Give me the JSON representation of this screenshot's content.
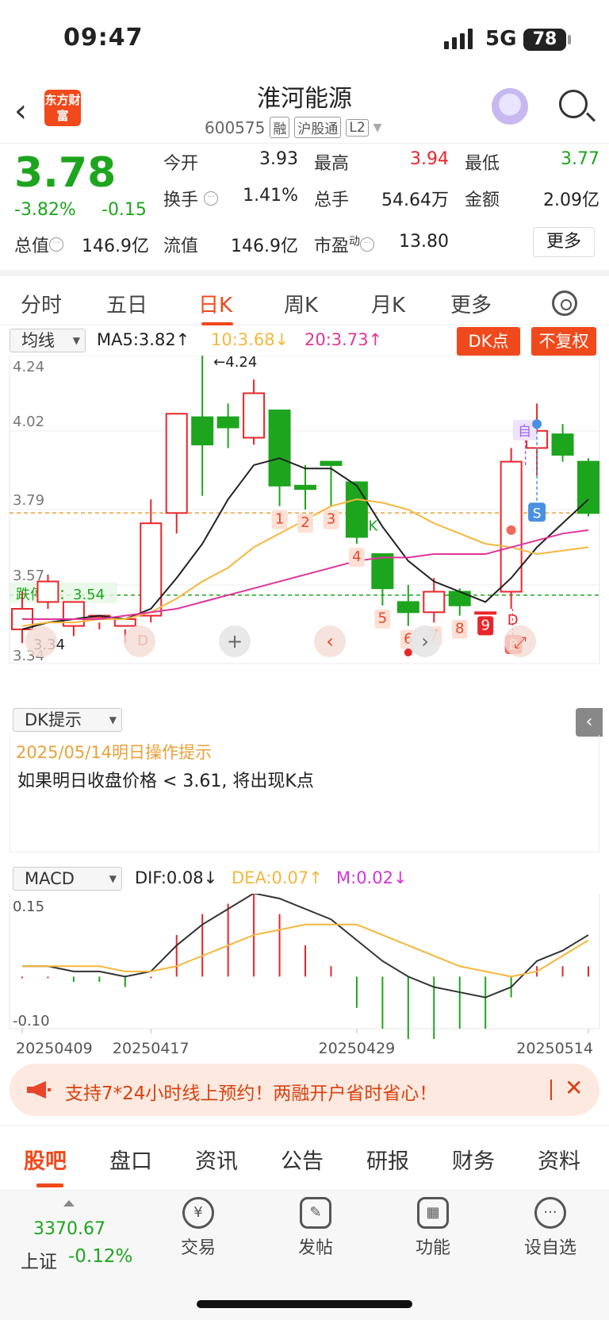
{
  "status": {
    "time": "09:47",
    "network": "5G",
    "battery": "78"
  },
  "header": {
    "back": "‹",
    "logo": "东方财富",
    "name": "淮河能源",
    "code": "600575",
    "tags": [
      "融",
      "沪股通",
      "L2"
    ]
  },
  "quote": {
    "price": "3.78",
    "pct": "-3.82%",
    "chg": "-0.15",
    "fields": {
      "open_label": "今开",
      "open": "3.93",
      "high_label": "最高",
      "high": "3.94",
      "low_label": "最低",
      "low": "3.77",
      "turnover_label": "换手",
      "turnover": "1.41%",
      "volume_label": "总手",
      "volume": "54.64万",
      "amount_label": "金额",
      "amount": "2.09亿",
      "mcap_label": "总值",
      "mcap": "146.9亿",
      "float_label": "流值",
      "float": "146.9亿",
      "pe_label": "市盈",
      "pe_sup": "动",
      "pe": "13.80"
    },
    "more": "更多"
  },
  "tabs": [
    "分时",
    "五日",
    "日K",
    "周K",
    "月K",
    "更多"
  ],
  "ma": {
    "selector": "均线",
    "ma5": "MA5:3.82↑",
    "ma10": "10:3.68↓",
    "ma20": "20:3.73↑",
    "dk_btn": "DK点",
    "fq_btn": "不复权"
  },
  "kline": {
    "y_labels": [
      "4.24",
      "4.02",
      "3.79",
      "3.57",
      "3.34"
    ],
    "stop_label": "跌停价：3.54",
    "max_label": "←4.24",
    "min_label": "3.34",
    "markers": [
      "1",
      "2",
      "3",
      "4",
      "5",
      "6",
      "7",
      "8",
      "9"
    ],
    "k_mark": "K",
    "d_marks": [
      "D",
      "D"
    ],
    "zi_mark": "自",
    "s_mark": "S",
    "b_mark": "B"
  },
  "dk": {
    "selector": "DK提示",
    "date": "2025/05/14明日操作提示",
    "text": "如果明日收盘价格 < 3.61, 将出现K点"
  },
  "macd_head": {
    "selector": "MACD",
    "dif": "DIF:0.08↓",
    "dea": "DEA:0.07↑",
    "m": "M:0.02↓"
  },
  "macd_axis": {
    "top": "0.15",
    "bottom": "-0.10",
    "dates": [
      "20250409",
      "20250417",
      "20250429",
      "20250514"
    ]
  },
  "banner": {
    "text": "支持7*24小时线上预约！两融开户省时省心！",
    "close": "✕"
  },
  "bottom_tabs": [
    "股吧",
    "盘口",
    "资讯",
    "公告",
    "研报",
    "财务",
    "资料"
  ],
  "dock": {
    "index_value": "3370.67",
    "index_name": "上证",
    "index_change": "-0.12%",
    "items": [
      "交易",
      "发帖",
      "功能",
      "设自选"
    ]
  },
  "colors": {
    "up": "#e8262a",
    "down": "#1ea51e",
    "accent": "#f04a1c",
    "ma5": "#222222",
    "ma10": "#f5b73c",
    "ma20": "#e0359a"
  },
  "chart_data": [
    {
      "type": "candlestick",
      "title": "",
      "x": [
        "20250409",
        "",
        "",
        "",
        "",
        "20250417",
        "",
        "",
        "",
        "",
        "",
        "",
        "",
        "20250429",
        "",
        "",
        "",
        "",
        "",
        "",
        "",
        "",
        "20250514"
      ],
      "ohlc": [
        [
          3.44,
          3.5,
          3.4,
          3.55
        ],
        [
          3.52,
          3.58,
          3.5,
          3.6
        ],
        [
          3.45,
          3.52,
          3.42,
          3.45
        ],
        [
          3.48,
          3.48,
          3.44,
          3.46
        ],
        [
          3.45,
          3.47,
          3.4,
          3.44
        ],
        [
          3.48,
          3.75,
          3.46,
          3.82
        ],
        [
          3.78,
          4.07,
          3.72,
          4.07
        ],
        [
          4.06,
          3.98,
          3.83,
          4.24
        ],
        [
          4.06,
          4.03,
          3.97,
          4.1
        ],
        [
          4.0,
          4.13,
          3.98,
          4.17
        ],
        [
          4.08,
          3.86,
          3.8,
          4.08
        ],
        [
          3.86,
          3.85,
          3.79,
          3.92
        ],
        [
          3.93,
          3.92,
          3.8,
          3.93
        ],
        [
          3.87,
          3.71,
          3.69,
          3.87
        ],
        [
          3.66,
          3.56,
          3.51,
          3.66
        ],
        [
          3.52,
          3.49,
          3.45,
          3.57
        ],
        [
          3.49,
          3.55,
          3.46,
          3.59
        ],
        [
          3.55,
          3.51,
          3.48,
          3.56
        ],
        [
          3.49,
          3.49,
          3.49,
          3.49
        ],
        [
          3.55,
          3.93,
          3.5,
          3.97
        ],
        [
          3.97,
          4.02,
          3.89,
          4.1
        ],
        [
          4.01,
          3.95,
          3.93,
          4.04
        ],
        [
          3.93,
          3.78,
          3.77,
          3.94
        ]
      ],
      "ma5": [
        3.44,
        3.46,
        3.47,
        3.48,
        3.47,
        3.5,
        3.59,
        3.69,
        3.82,
        3.92,
        3.94,
        3.91,
        3.91,
        3.86,
        3.74,
        3.64,
        3.58,
        3.55,
        3.52,
        3.59,
        3.68,
        3.75,
        3.82
      ],
      "ma10": [
        3.45,
        3.46,
        3.46,
        3.47,
        3.47,
        3.49,
        3.53,
        3.58,
        3.62,
        3.68,
        3.72,
        3.76,
        3.8,
        3.82,
        3.81,
        3.79,
        3.75,
        3.72,
        3.69,
        3.68,
        3.66,
        3.67,
        3.68
      ],
      "ma20": [
        3.47,
        3.47,
        3.47,
        3.47,
        3.48,
        3.49,
        3.5,
        3.52,
        3.54,
        3.56,
        3.58,
        3.6,
        3.62,
        3.64,
        3.65,
        3.65,
        3.66,
        3.66,
        3.66,
        3.68,
        3.7,
        3.72,
        3.73
      ],
      "ylim": [
        3.34,
        4.24
      ],
      "limit_down": 3.54
    },
    {
      "type": "bar",
      "title": "MACD",
      "x": [
        "20250409",
        "",
        "",
        "",
        "",
        "20250417",
        "",
        "",
        "",
        "",
        "",
        "",
        "",
        "20250429",
        "",
        "",
        "",
        "",
        "",
        "",
        "",
        "",
        "20250514"
      ],
      "dif": [
        0.02,
        0.02,
        0.01,
        0.01,
        0.0,
        0.01,
        0.06,
        0.1,
        0.13,
        0.16,
        0.15,
        0.13,
        0.11,
        0.07,
        0.03,
        0.0,
        -0.02,
        -0.03,
        -0.04,
        -0.02,
        0.03,
        0.05,
        0.08
      ],
      "dea": [
        0.02,
        0.02,
        0.02,
        0.02,
        0.01,
        0.01,
        0.02,
        0.04,
        0.06,
        0.08,
        0.09,
        0.1,
        0.1,
        0.1,
        0.08,
        0.06,
        0.04,
        0.02,
        0.01,
        0.0,
        0.01,
        0.04,
        0.07
      ],
      "macd": [
        0.0,
        0.0,
        -0.01,
        -0.01,
        -0.02,
        0.0,
        0.08,
        0.12,
        0.14,
        0.16,
        0.12,
        0.06,
        0.02,
        -0.06,
        -0.1,
        -0.12,
        -0.12,
        -0.1,
        -0.1,
        -0.04,
        0.02,
        0.02,
        0.02
      ],
      "ylim": [
        -0.1,
        0.15
      ]
    }
  ]
}
